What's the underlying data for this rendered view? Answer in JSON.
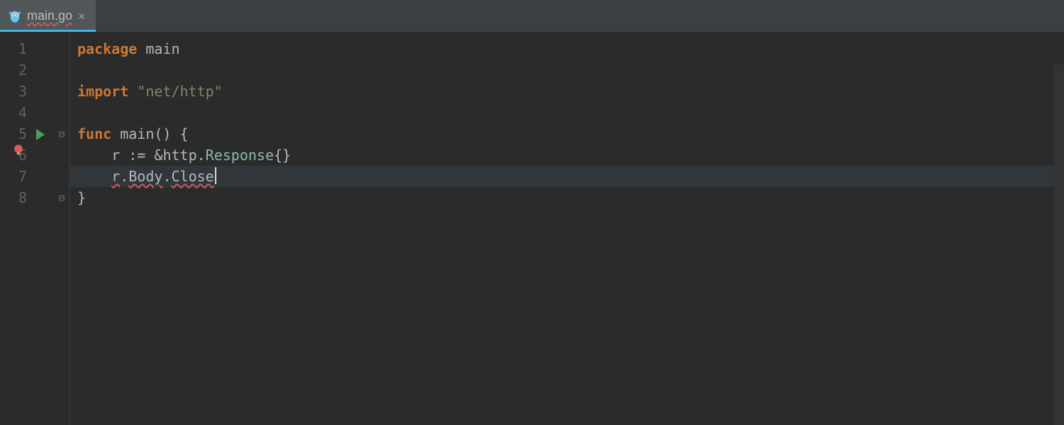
{
  "tab": {
    "filename": "main.go",
    "close_label": "×",
    "icon": "gopher-icon"
  },
  "colors": {
    "keyword": "#cc7832",
    "identifier": "#b2b8bd",
    "type": "#8cbbad",
    "string": "#79886b",
    "tab_underline": "#3eb6e2",
    "error_underline": "#d05c5c",
    "run_triangle": "#4e9c55",
    "intention_bulb": "#e35959"
  },
  "gutter": {
    "line_numbers": [
      "1",
      "2",
      "3",
      "4",
      "5",
      "6",
      "7",
      "8"
    ],
    "run_marker_line": 5,
    "fold_open_line": 5,
    "fold_close_line": 8,
    "intention_bulb_line": 6
  },
  "code": {
    "lines": [
      {
        "indent": "",
        "tokens": [
          {
            "cls": "kw",
            "t": "package"
          },
          {
            "cls": "",
            "t": " "
          },
          {
            "cls": "ident",
            "t": "main"
          }
        ]
      },
      {
        "indent": "",
        "tokens": []
      },
      {
        "indent": "",
        "tokens": [
          {
            "cls": "kw",
            "t": "import"
          },
          {
            "cls": "",
            "t": " "
          },
          {
            "cls": "str",
            "t": "\"net/http\""
          }
        ]
      },
      {
        "indent": "",
        "tokens": []
      },
      {
        "indent": "",
        "tokens": [
          {
            "cls": "kw",
            "t": "func"
          },
          {
            "cls": "",
            "t": " "
          },
          {
            "cls": "ident",
            "t": "main"
          },
          {
            "cls": "punct",
            "t": "() {"
          }
        ]
      },
      {
        "indent": "    ",
        "tokens": [
          {
            "cls": "ident",
            "t": "r"
          },
          {
            "cls": "",
            "t": " "
          },
          {
            "cls": "punct",
            "t": ":="
          },
          {
            "cls": "",
            "t": " "
          },
          {
            "cls": "punct",
            "t": "&"
          },
          {
            "cls": "ident",
            "t": "http"
          },
          {
            "cls": "punct",
            "t": "."
          },
          {
            "cls": "type",
            "t": "Response"
          },
          {
            "cls": "punct",
            "t": "{}"
          }
        ]
      },
      {
        "indent": "    ",
        "current": true,
        "caret_after": true,
        "tokens": [
          {
            "cls": "ident err",
            "t": "r"
          },
          {
            "cls": "punct",
            "t": "."
          },
          {
            "cls": "ident err",
            "t": "Body"
          },
          {
            "cls": "punct",
            "t": "."
          },
          {
            "cls": "ident err",
            "t": "Close"
          }
        ]
      },
      {
        "indent": "",
        "tokens": [
          {
            "cls": "punct",
            "t": "}"
          }
        ]
      }
    ]
  }
}
